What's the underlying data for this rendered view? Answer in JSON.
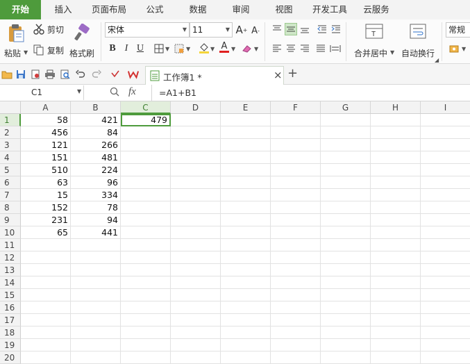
{
  "menu": {
    "tabs": [
      {
        "label": "开始",
        "active": true
      },
      {
        "label": "插入",
        "active": false
      },
      {
        "label": "页面布局",
        "active": false
      },
      {
        "label": "公式",
        "active": false
      },
      {
        "label": "数据",
        "active": false
      },
      {
        "label": "审阅",
        "active": false
      },
      {
        "label": "视图",
        "active": false
      },
      {
        "label": "开发工具",
        "active": false
      },
      {
        "label": "云服务",
        "active": false
      }
    ]
  },
  "ribbon": {
    "paste_label": "粘贴",
    "cut_label": "剪切",
    "copy_label": "复制",
    "format_painter_label": "格式刷",
    "font_name": "宋体",
    "font_size": "11",
    "bold": "B",
    "italic": "I",
    "underline": "U",
    "font_color_letter": "A",
    "merge_center_label": "合并居中",
    "wrap_text_label": "自动换行",
    "number_format": "常规",
    "merge_icon_letter": "T"
  },
  "quickbar": {
    "doc_tab_title": "工作簿1 *",
    "close_symbol": "×",
    "new_tab_symbol": "+"
  },
  "formula": {
    "name_box": "C1",
    "fx_label": "fx",
    "content": "=A1+B1"
  },
  "sheet": {
    "columns": [
      "A",
      "B",
      "C",
      "D",
      "E",
      "F",
      "G",
      "H",
      "I"
    ],
    "selected_column": "C",
    "rows": [
      "1",
      "2",
      "3",
      "4",
      "5",
      "6",
      "7",
      "8",
      "9",
      "10",
      "11",
      "12",
      "13",
      "14",
      "15",
      "16",
      "17",
      "18",
      "19",
      "20"
    ],
    "selected_row": "1",
    "values": {
      "A": [
        "58",
        "456",
        "121",
        "151",
        "510",
        "63",
        "15",
        "152",
        "231",
        "65"
      ],
      "B": [
        "421",
        "84",
        "266",
        "481",
        "224",
        "96",
        "334",
        "78",
        "94",
        "441"
      ],
      "C": [
        "479"
      ]
    }
  },
  "colors": {
    "accent": "#4e9b3c"
  }
}
